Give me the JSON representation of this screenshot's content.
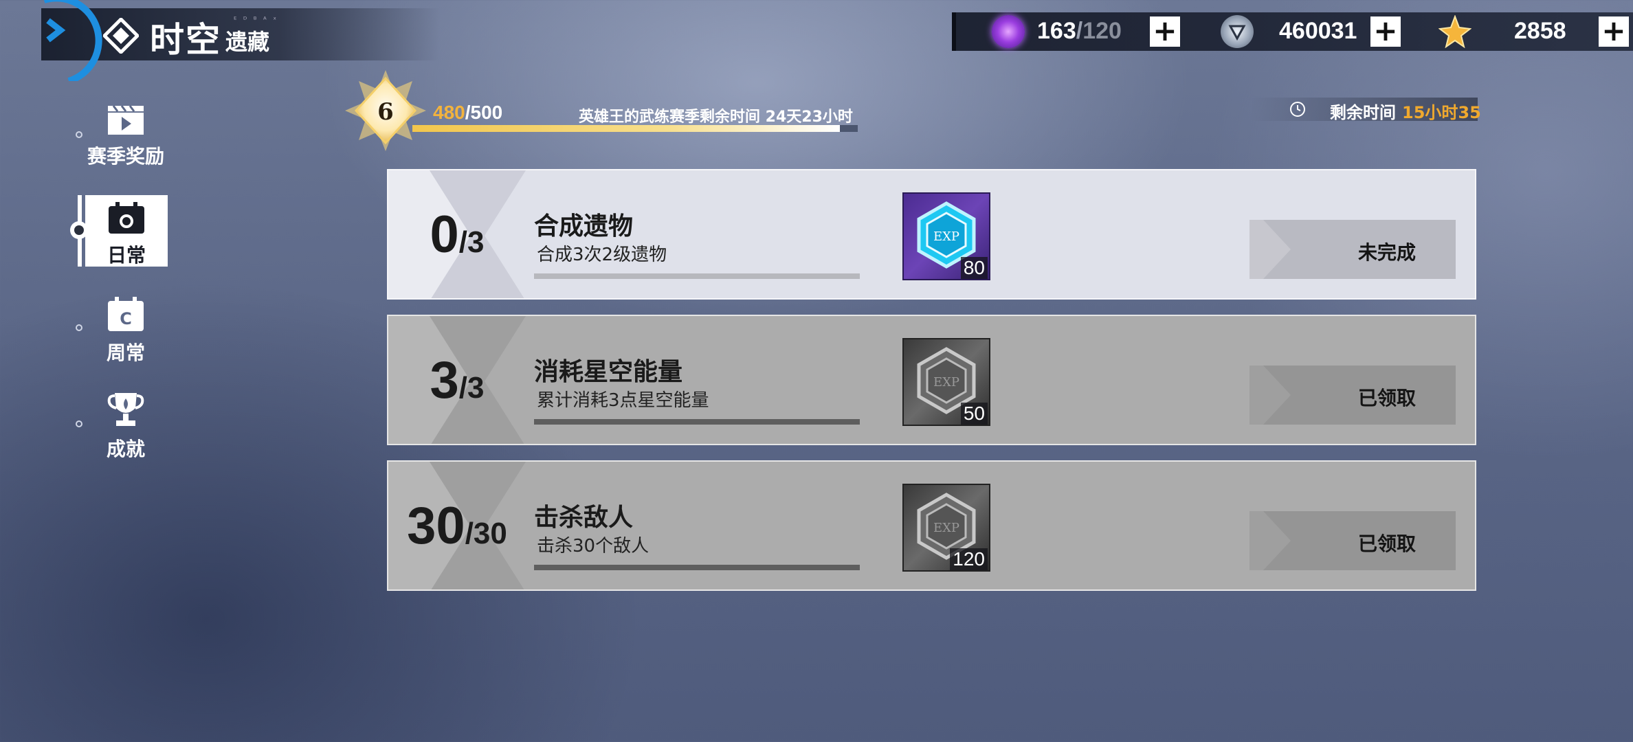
{
  "header": {
    "title_main": "时空",
    "title_sub": "遗藏",
    "title_tiny": "ᴱ ᴰ ᴮ ᴬ ˣ"
  },
  "currency": [
    {
      "name": "stamina",
      "icon": "purple-orb-icon",
      "current": "163",
      "max": "120"
    },
    {
      "name": "coins",
      "icon": "silver-emblem-icon",
      "value": "460031"
    },
    {
      "name": "stars",
      "icon": "gold-star-icon",
      "value": "2858"
    }
  ],
  "sidebar": {
    "items": [
      {
        "label": "赛季奖励",
        "icon": "clapperboard-icon"
      },
      {
        "label": "日常",
        "icon": "calendar-icon",
        "selected": true
      },
      {
        "label": "周常",
        "icon": "weekly-calendar-icon"
      },
      {
        "label": "成就",
        "icon": "trophy-icon"
      }
    ]
  },
  "season": {
    "level": "6",
    "exp_current": "480",
    "exp_max": "500",
    "exp_fraction": 0.96,
    "season_text": "英雄王的武练赛季剩余时间 24天23小时",
    "timer_label": "剩余时间",
    "timer_value": "15小时35"
  },
  "tasks": [
    {
      "count": "0",
      "total": "/3",
      "title": "合成遗物",
      "desc": "合成3次2级遗物",
      "reward_label": "EXP",
      "reward_qty": "80",
      "status": "未完成",
      "state": "active"
    },
    {
      "count": "3",
      "total": "/3",
      "title": "消耗星空能量",
      "desc": "累计消耗3点星空能量",
      "reward_label": "EXP",
      "reward_qty": "50",
      "status": "已领取",
      "state": "done"
    },
    {
      "count": "30",
      "total": "/30",
      "title": "击杀敌人",
      "desc": "击杀30个敌人",
      "reward_label": "EXP",
      "reward_qty": "120",
      "status": "已领取",
      "state": "done"
    }
  ],
  "colors": {
    "accent_gold": "#f0a92e",
    "exp_orange": "#f3b33d",
    "back_blue": "#1e8fe0"
  }
}
